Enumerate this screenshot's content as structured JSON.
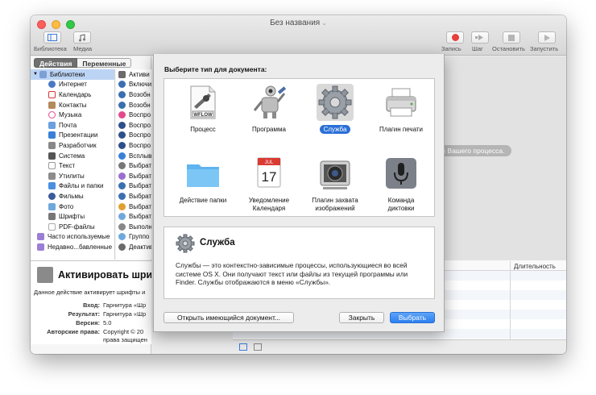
{
  "window": {
    "title": "Без названия"
  },
  "toolbar": {
    "library_label": "Библиотека",
    "media_label": "Медиа",
    "record_label": "Запись",
    "step_label": "Шаг",
    "stop_label": "Остановить",
    "run_label": "Запустить"
  },
  "tabs": {
    "actions": "Действия",
    "variables": "Переменные"
  },
  "library": {
    "root": "Библиотеки",
    "items": [
      "Интернет",
      "Календарь",
      "Контакты",
      "Музыка",
      "Почта",
      "Презентации",
      "Разработчик",
      "Система",
      "Текст",
      "Утилиты",
      "Файлы и папки",
      "Фильмы",
      "Фото",
      "Шрифты",
      "PDF-файлы"
    ],
    "extra": [
      "Часто используемые",
      "Недавно...бавленные"
    ]
  },
  "actions_list": [
    "Активи",
    "Включи",
    "Возобн",
    "Возобн",
    "Воспро",
    "Воспро",
    "Воспро",
    "Воспро",
    "Всплыв",
    "Выбрат",
    "Выбрат",
    "Выбрат",
    "Выбрат",
    "Выбрат",
    "Выбрат",
    "Выполн",
    "Группо",
    "Деактив"
  ],
  "description": {
    "title": "Активировать шриф",
    "text": "Данное действие активирует шрифты и",
    "input_key": "Вход:",
    "input_val": "Гарнитура «Шр",
    "result_key": "Результат:",
    "result_val": "Гарнитура «Шр",
    "version_key": "Версия:",
    "version_val": "5.0",
    "copyright_key": "Авторские права:",
    "copyright_val": "Copyright © 20",
    "copyright_val2": "права защищен"
  },
  "workflow": {
    "hint_partial": "ния Вашего процесса."
  },
  "log": {
    "duration_header": "Длительность"
  },
  "dialog": {
    "prompt": "Выберите тип для документа:",
    "types": [
      {
        "label": "Процесс",
        "icon": "workflow-document-icon",
        "badge": "WFLOW"
      },
      {
        "label": "Программа",
        "icon": "robot-application-icon"
      },
      {
        "label": "Служба",
        "icon": "gear-service-icon",
        "selected": true
      },
      {
        "label": "Плагин печати",
        "icon": "printer-plugin-icon"
      },
      {
        "label": "Действие папки",
        "icon": "folder-action-icon"
      },
      {
        "label": "Уведомление\nКалендаря",
        "label1": "Уведомление",
        "label2": "Календаря",
        "icon": "calendar-alarm-icon",
        "month": "JUL",
        "day": "17"
      },
      {
        "label": "Плагин захвата\nизображений",
        "label1": "Плагин захвата",
        "label2": "изображений",
        "icon": "image-capture-icon"
      },
      {
        "label": "Команда\nдиктовки",
        "label1": "Команда",
        "label2": "диктовки",
        "icon": "dictation-microphone-icon"
      }
    ],
    "info": {
      "title": "Служба",
      "text": "Службы — это контекстно-зависимые процессы, использующиеся во всей системе OS X. Они получают текст или файлы из текущей программы или Finder. Службы отображаются в меню «Службы»."
    },
    "open_existing": "Открыть имеющийся документ...",
    "close": "Закрыть",
    "choose": "Выбрать"
  },
  "colors": {
    "accent": "#2c7ff0",
    "selection": "#bcd4f4",
    "record": "#e8403c"
  }
}
